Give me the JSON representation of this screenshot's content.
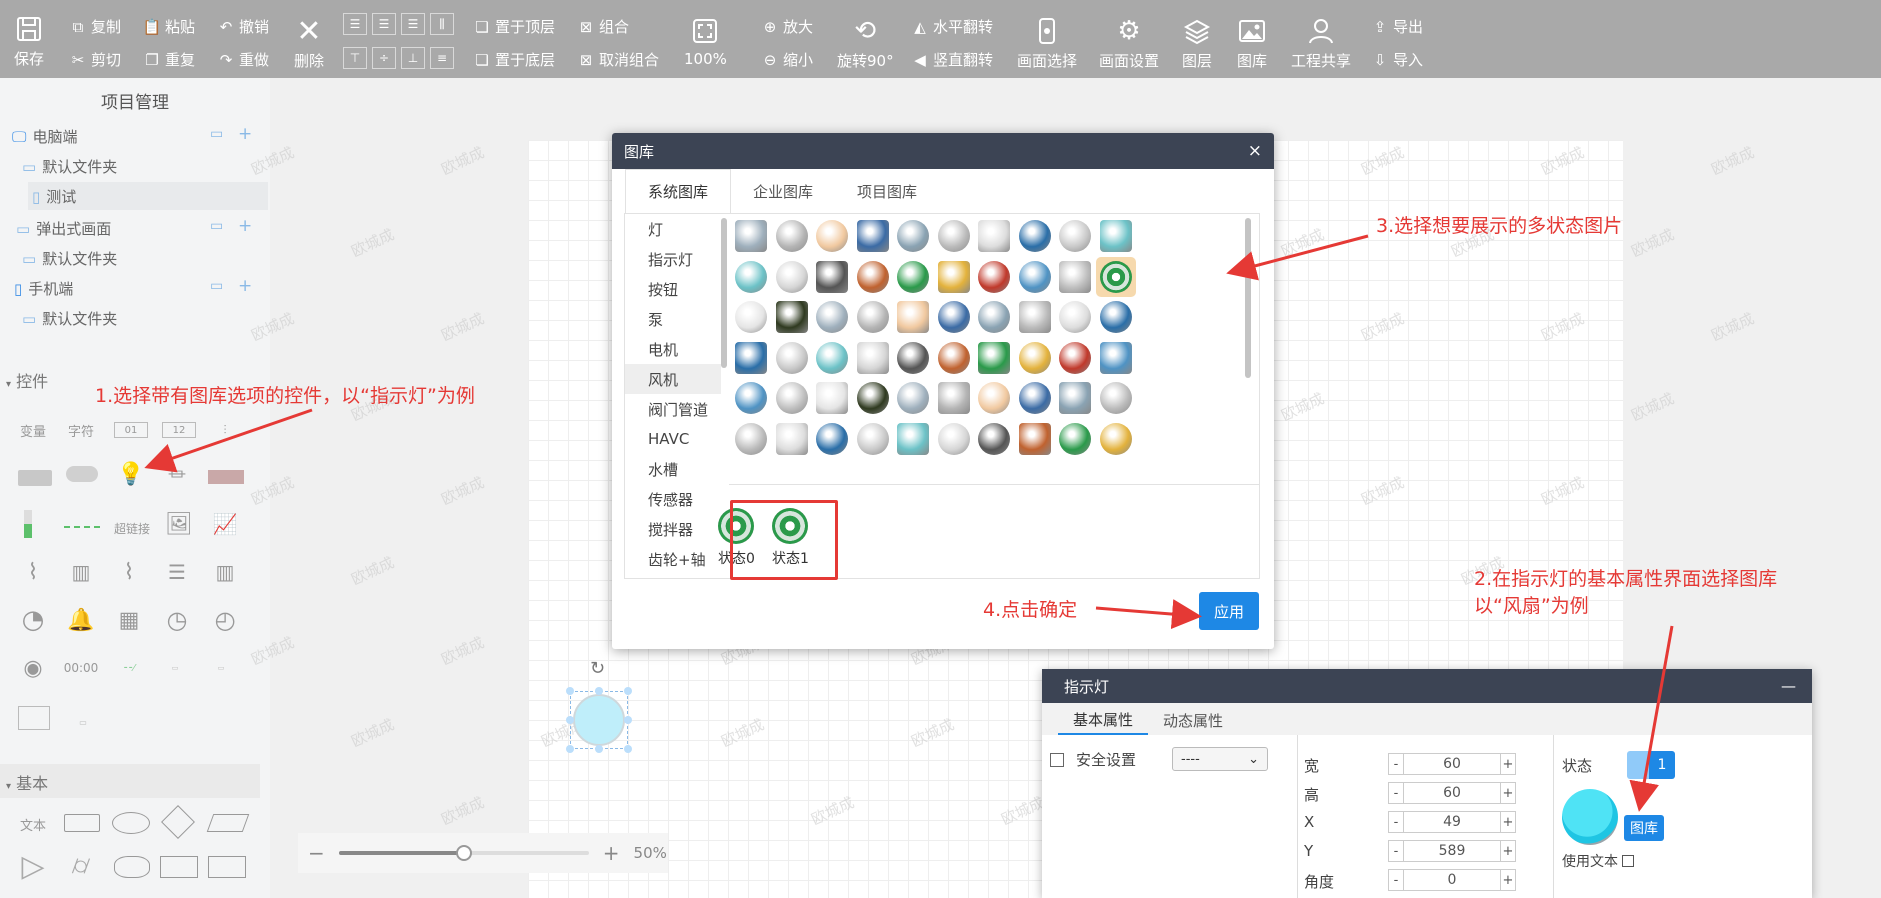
{
  "toolbar": {
    "save": "保存",
    "copy": "复制",
    "cut": "剪切",
    "paste": "粘贴",
    "repeat": "重复",
    "undo": "撤销",
    "redo": "重做",
    "delete": "删除",
    "bring_top": "置于顶层",
    "send_bottom": "置于底层",
    "group": "组合",
    "ungroup": "取消组合",
    "zoom_level": "100%",
    "zoom_in": "放大",
    "zoom_out": "缩小",
    "rotate": "旋转90°",
    "flip_h": "水平翻转",
    "flip_v": "竖直翻转",
    "screen_select": "画面选择",
    "screen_settings": "画面设置",
    "layers": "图层",
    "gallery": "图库",
    "share": "工程共享",
    "export": "导出",
    "import": "导入"
  },
  "sidebar": {
    "title": "项目管理",
    "pc": "电脑端",
    "pc_folder": "默认文件夹",
    "pc_test": "测试",
    "popup": "弹出式画面",
    "popup_folder": "默认文件夹",
    "mobile": "手机端",
    "mobile_folder": "默认文件夹",
    "controls": "控件",
    "ctl_var": "变量",
    "ctl_str": "字符",
    "ctl_num1": "01",
    "ctl_num2": "12",
    "ctl_link": "超链接",
    "ctl_time": "00:00",
    "basic": "基本",
    "basic_text": "文本"
  },
  "zoom": {
    "minus": "−",
    "plus": "+",
    "value": "50%"
  },
  "watermark": "欧城成",
  "gallery_dialog": {
    "title": "图库",
    "close": "×",
    "tabs": [
      "系统图库",
      "企业图库",
      "项目图库"
    ],
    "categories": [
      "灯",
      "指示灯",
      "按钮",
      "泵",
      "电机",
      "风机",
      "阀门管道",
      "HAVC",
      "水槽",
      "传感器",
      "搅拌器",
      "齿轮+轴"
    ],
    "selected_category": "风机",
    "states": [
      "状态0",
      "状态1"
    ],
    "apply": "应用"
  },
  "annotations": {
    "step1": "1.选择带有图库选项的控件，以“指示灯”为例",
    "step2_line1": "2.在指示灯的基本属性界面选择图库",
    "step2_line2": "以“风扇”为例",
    "step3": "3.选择想要展示的多状态图片",
    "step4": "4.点击确定"
  },
  "panel": {
    "title": "指示灯",
    "minimize": "—",
    "tab_basic": "基本属性",
    "tab_dynamic": "动态属性",
    "security": "安全设置",
    "security_value": "----",
    "width_label": "宽",
    "width": "60",
    "height_label": "高",
    "height": "60",
    "x_label": "X",
    "x": "49",
    "y_label": "Y",
    "y": "589",
    "angle_label": "角度",
    "angle": "0",
    "state_label": "状态",
    "state_value": "1",
    "gallery_button": "图库",
    "use_text": "使用文本"
  },
  "colors": {
    "accent": "#1e88e5",
    "annotation": "#e53935",
    "header": "#3c4454",
    "toolbar": "#a9a9a9"
  }
}
